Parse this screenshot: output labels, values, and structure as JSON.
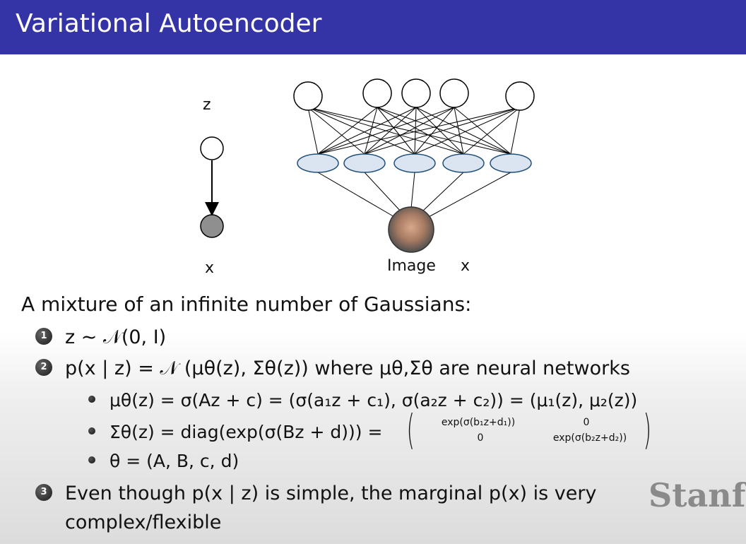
{
  "header": {
    "title": "Variational Autoencoder"
  },
  "figure": {
    "latent_label": "z",
    "observed_label": "x",
    "image_label": "Image",
    "image_var": "x"
  },
  "content": {
    "lead": "A mixture of an infinite number of Gaussians:",
    "items": [
      {
        "number": "1",
        "text": "z ∼ 𝒩(0, I)"
      },
      {
        "number": "2",
        "text": "p(x | z) = 𝒩 (μθ(z), Σθ(z)) where μθ,Σθ are neural networks"
      },
      {
        "number": "3",
        "text": "Even though p(x | z) is simple, the marginal p(x) is very",
        "continuation": "complex/flexible"
      }
    ],
    "subitems": [
      "μθ(z) = σ(Az + c) = (σ(a₁z + c₁), σ(a₂z + c₂)) = (μ₁(z), μ₂(z))",
      "Σθ(z) = diag(exp(σ(Bz + d))) =",
      "θ = (A, B, c, d)"
    ],
    "matrix": {
      "r1c1": "exp(σ(b₁z+d₁))",
      "r1c2": "0",
      "r2c1": "0",
      "r2c2": "exp(σ(b₂z+d₂))"
    }
  },
  "watermark": "Stanfo"
}
